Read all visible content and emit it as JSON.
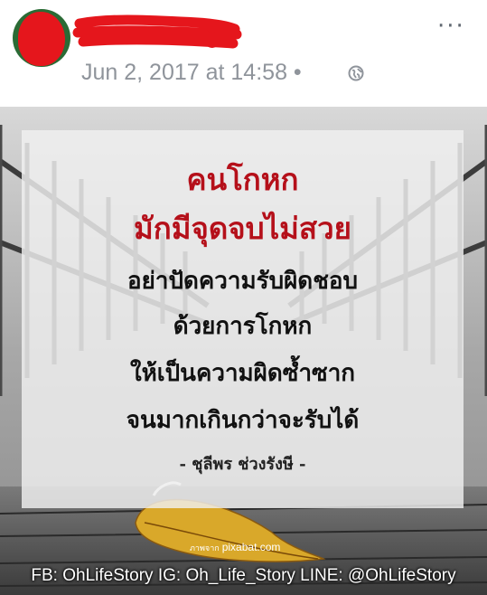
{
  "post": {
    "timestamp": "Jun 2, 2017 at 14:58",
    "separator": "•",
    "privacy_icon": "globe-icon",
    "more_icon": "more-icon",
    "more_glyph": "···"
  },
  "image": {
    "title_lines": [
      "คนโกหก",
      "มักมีจุดจบไม่สวย"
    ],
    "body_lines": [
      "อย่าปัดความรับผิดชอบ",
      "ด้วยการโกหก",
      "ให้เป็นความผิดซ้ำซาก",
      "จนมากเกินกว่าจะรับได้"
    ],
    "signature": "- ชุลีพร ช่วงรังษี -",
    "credit_prefix": "ภาพจาก",
    "credit": "pixabat.com",
    "footer": "FB: OhLifeStory IG: Oh_Life_Story LINE: @OhLifeStory",
    "colors": {
      "title": "#b5101a",
      "body": "#111111"
    }
  }
}
